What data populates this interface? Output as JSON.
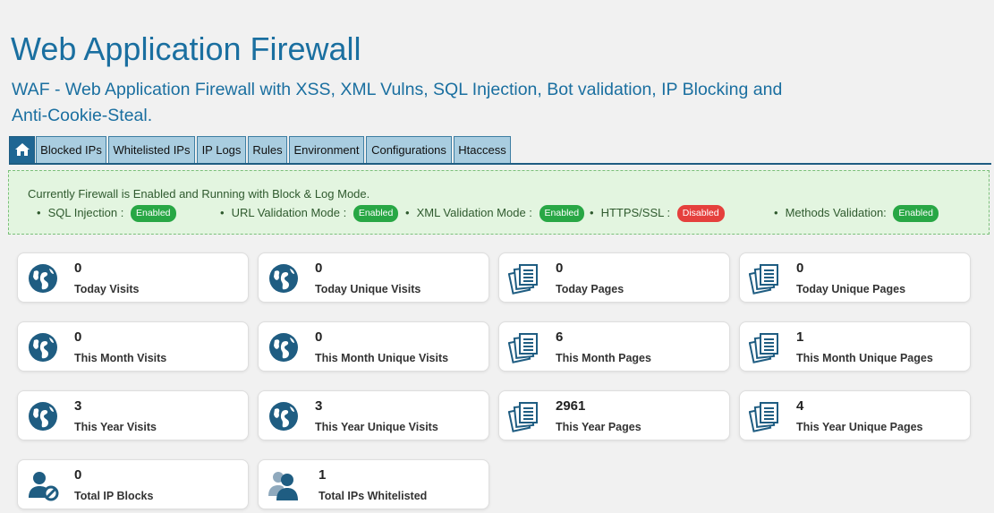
{
  "header": {
    "title": "Web Application Firewall",
    "subtitle": "WAF - Web Application Firewall with XSS, XML Vulns, SQL Injection, Bot validation, IP Blocking and Anti-Cookie-Steal."
  },
  "tabs": [
    {
      "label": ""
    },
    {
      "label": "Blocked IPs"
    },
    {
      "label": "Whitelisted IPs"
    },
    {
      "label": "IP Logs"
    },
    {
      "label": "Rules"
    },
    {
      "label": "Environment"
    },
    {
      "label": "Configurations"
    },
    {
      "label": "Htaccess"
    }
  ],
  "status": {
    "message": "Currently Firewall is Enabled and Running with Block & Log Mode.",
    "items": [
      {
        "label": "SQL Injection :",
        "badge": "Enabled"
      },
      {
        "label": "URL Validation Mode :",
        "badge": "Enabled"
      },
      {
        "label": "XML Validation Mode :",
        "badge": "Enabled"
      },
      {
        "label": "HTTPS/SSL :",
        "badge": "Disabled"
      },
      {
        "label": "Methods Validation:",
        "badge": "Enabled"
      }
    ]
  },
  "stats": [
    {
      "value": "0",
      "label": "Today Visits",
      "icon": "globe-icon"
    },
    {
      "value": "0",
      "label": "Today Unique Visits",
      "icon": "globe-icon"
    },
    {
      "value": "0",
      "label": "Today Pages",
      "icon": "pages-icon"
    },
    {
      "value": "0",
      "label": "Today Unique Pages",
      "icon": "pages-icon"
    },
    {
      "value": "0",
      "label": "This Month Visits",
      "icon": "globe-icon"
    },
    {
      "value": "0",
      "label": "This Month Unique Visits",
      "icon": "globe-icon"
    },
    {
      "value": "6",
      "label": "This Month Pages",
      "icon": "pages-icon"
    },
    {
      "value": "1",
      "label": "This Month Unique Pages",
      "icon": "pages-icon"
    },
    {
      "value": "3",
      "label": "This Year Visits",
      "icon": "globe-icon"
    },
    {
      "value": "3",
      "label": "This Year Unique Visits",
      "icon": "globe-icon"
    },
    {
      "value": "2961",
      "label": "This Year Pages",
      "icon": "pages-icon"
    },
    {
      "value": "4",
      "label": "This Year Unique Pages",
      "icon": "pages-icon"
    },
    {
      "value": "0",
      "label": "Total IP Blocks",
      "icon": "user-blocked-icon"
    },
    {
      "value": "1",
      "label": "Total IPs Whitelisted",
      "icon": "users-icon"
    }
  ],
  "colors": {
    "accent": "#1a6fa0",
    "tab": "#a9cde0",
    "enabled": "#28a745",
    "disabled": "#e5403d",
    "status_bg": "#e3f5e0"
  }
}
